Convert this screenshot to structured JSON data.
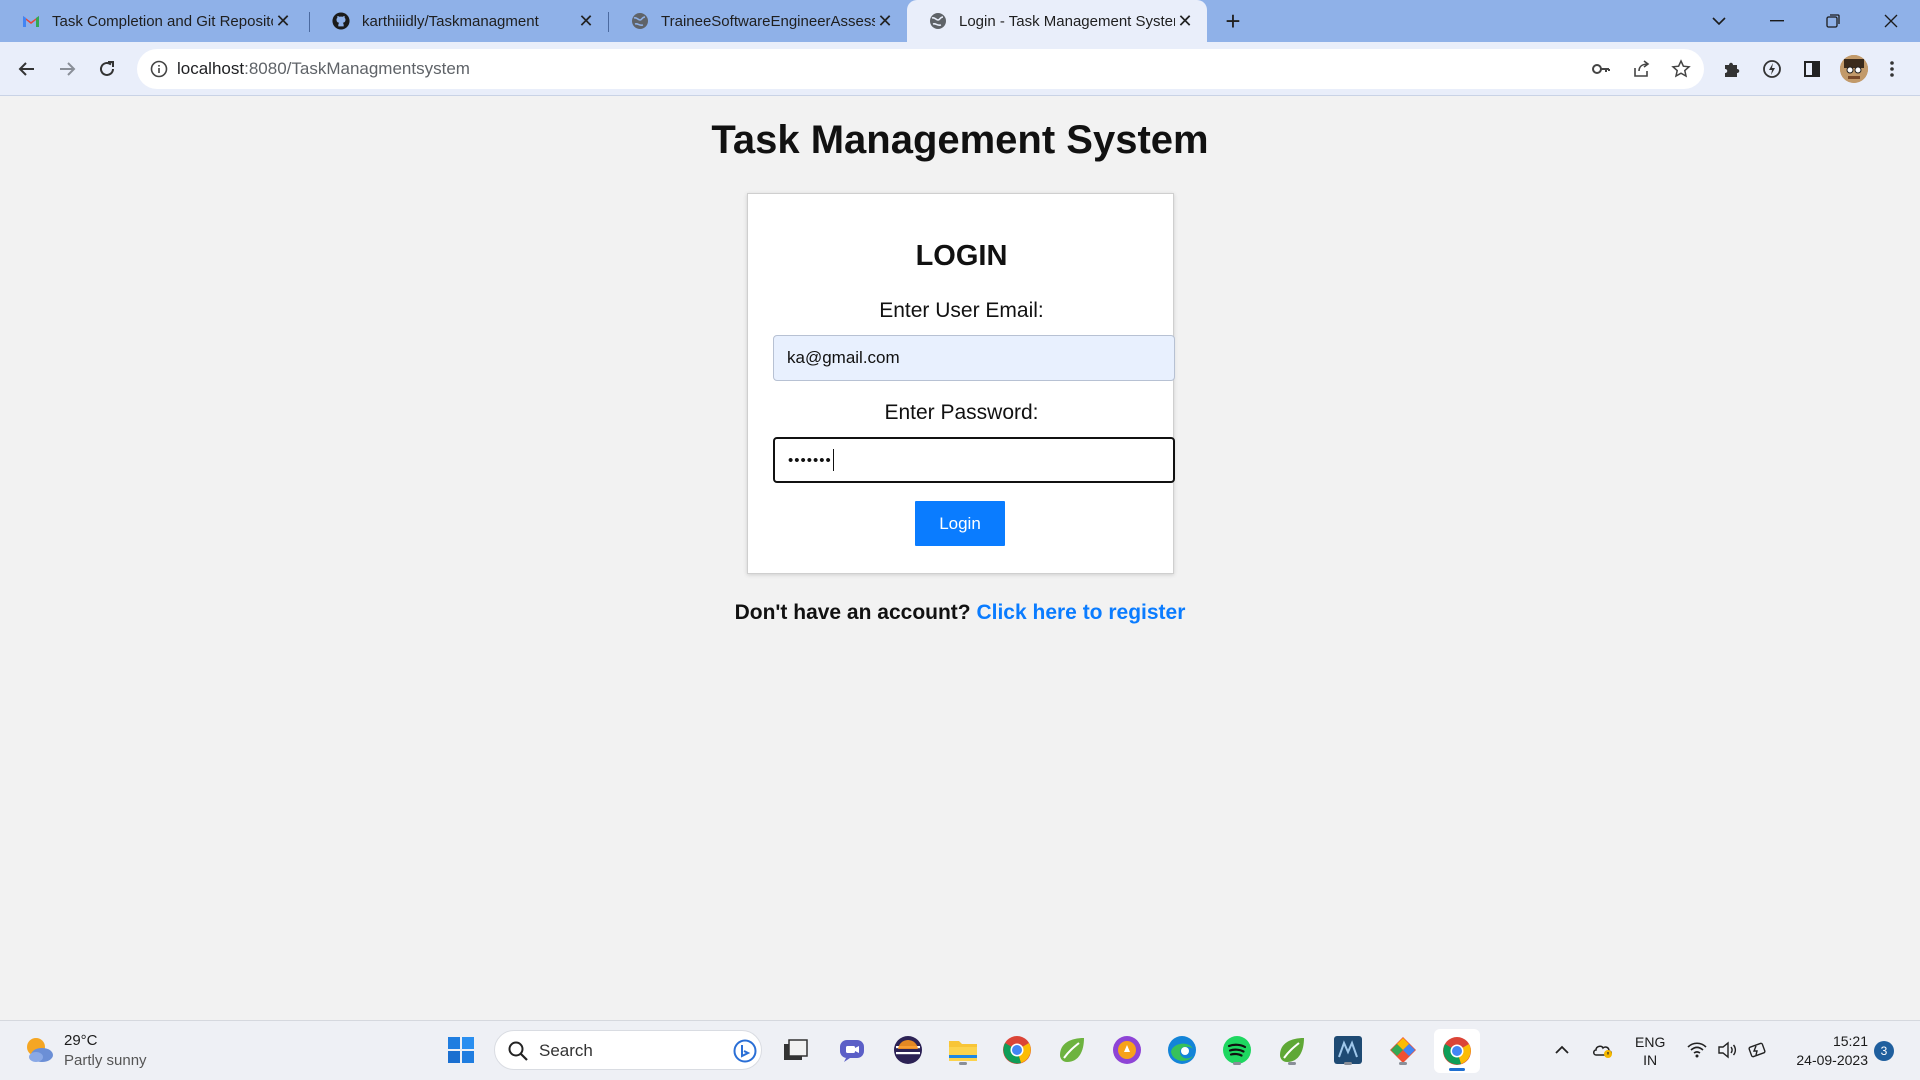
{
  "browser": {
    "tabs": [
      {
        "title": "Task Completion and Git Repositor",
        "favicon": "gmail-icon"
      },
      {
        "title": "karthiiidly/Taskmanagment",
        "favicon": "github-icon"
      },
      {
        "title": "TraineeSoftwareEngineerAssessm",
        "favicon": "globe-icon"
      },
      {
        "title": "Login - Task Management System",
        "favicon": "globe-icon",
        "active": true
      }
    ],
    "address": {
      "host": "localhost",
      "path": ":8080/TaskManagmentsystem"
    }
  },
  "page": {
    "title": "Task Management System",
    "login": {
      "heading": "LOGIN",
      "email_label": "Enter User Email:",
      "email_value": "ka@gmail.com",
      "password_label": "Enter Password:",
      "password_mask": "•••••••",
      "button": "Login"
    },
    "register": {
      "prompt": "Don't have an account?",
      "link": "Click here to register"
    }
  },
  "taskbar": {
    "weather": {
      "temp": "29°C",
      "desc": "Partly sunny"
    },
    "search_label": "Search",
    "language": {
      "line1": "ENG",
      "line2": "IN"
    },
    "time": "15:21",
    "date": "24-09-2023",
    "notifications": "3"
  },
  "colors": {
    "accent": "#0a7cff",
    "tabstrip": "#8fb1e8",
    "toolbar": "#e9eefa",
    "page_bg": "#f2f2f2"
  }
}
